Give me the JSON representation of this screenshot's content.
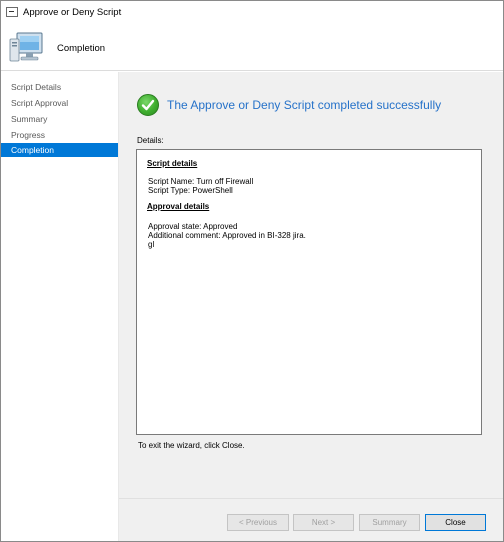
{
  "window": {
    "title": "Approve or Deny Script"
  },
  "header": {
    "page_title": "Completion"
  },
  "sidebar": {
    "items": [
      {
        "label": "Script Details",
        "active": false
      },
      {
        "label": "Script Approval",
        "active": false
      },
      {
        "label": "Summary",
        "active": false
      },
      {
        "label": "Progress",
        "active": false
      },
      {
        "label": "Completion",
        "active": true
      }
    ]
  },
  "main": {
    "status_text": "The Approve or Deny Script completed successfully",
    "details_label": "Details:",
    "details": {
      "script_header": "Script details",
      "script_name": "Script Name: Turn off Firewall",
      "script_type": "Script Type: PowerShell",
      "approval_header": "Approval details",
      "approval_state": "Approval state: Approved",
      "additional_comment": "Additional comment: Approved in BI-328 jira.",
      "comment_extra": "gl"
    },
    "exit_text": "To exit the wizard, click Close."
  },
  "footer": {
    "previous_label": "< Previous",
    "next_label": "Next >",
    "summary_label": "Summary",
    "close_label": "Close"
  },
  "colors": {
    "accent": "#0078d7",
    "status_text": "#2672c9",
    "success_green": "#3fae2f",
    "panel_bg": "#f0f0f0"
  },
  "icons": {
    "title_icon": "window-app-icon",
    "header_icon": "computer-monitor-icon",
    "status_icon": "success-check-icon"
  }
}
